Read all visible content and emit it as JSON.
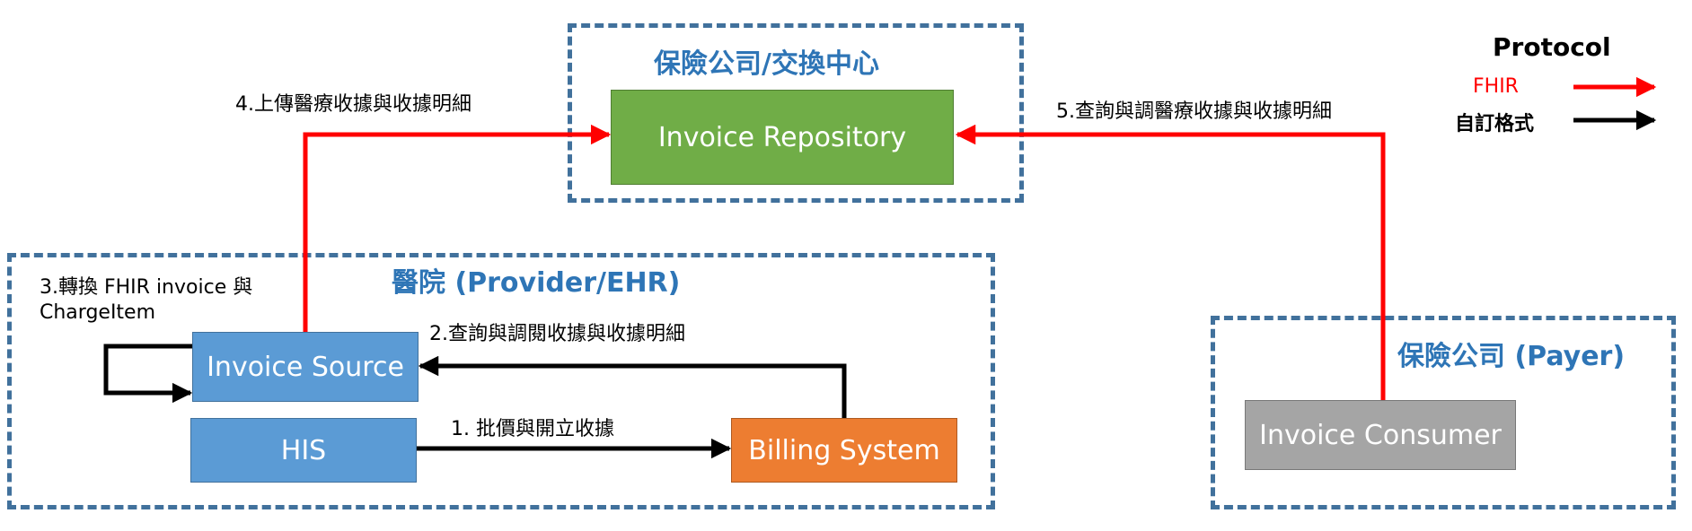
{
  "zones": {
    "insurer_exchange": "保險公司/交換中心",
    "hospital": "醫院 (Provider/EHR)",
    "payer": "保險公司 (Payer)"
  },
  "boxes": {
    "invoice_repository": "Invoice Repository",
    "invoice_source": "Invoice Source",
    "his": "HIS",
    "billing_system": "Billing System",
    "invoice_consumer": "Invoice Consumer"
  },
  "steps": {
    "step1": "1. 批價與開立收據",
    "step2": "2.查詢與調閱收據與收據明細",
    "step3_line1": "3.轉換 FHIR invoice 與",
    "step3_line2": "ChargeItem",
    "step4": "4.上傳醫療收據與收據明細",
    "step5": "5.查詢與調醫療收據與收據明細"
  },
  "legend": {
    "title": "Protocol",
    "fhir": "FHIR",
    "custom": "自訂格式"
  },
  "colors": {
    "fhir": "#ff0000",
    "custom": "#000000",
    "zone_border": "#41719c",
    "zone_title": "#2e75b6"
  }
}
